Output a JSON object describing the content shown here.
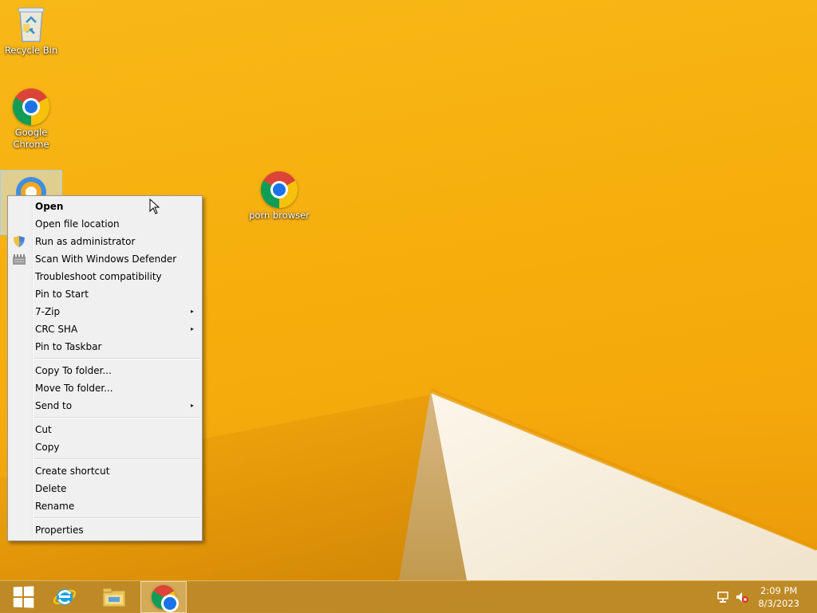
{
  "desktop": {
    "icons": [
      {
        "label": "Recycle Bin",
        "icon": "recycle-bin-icon"
      },
      {
        "label": "Google Chrome",
        "label_line1": "Google",
        "label_line2": "Chrome",
        "icon": "chrome-icon"
      },
      {
        "label": "porn browser",
        "icon": "chrome-icon"
      }
    ],
    "selected_icon": "tor-browser-icon"
  },
  "context_menu": {
    "items": [
      {
        "label": "Open",
        "bold": true
      },
      {
        "label": "Open file location"
      },
      {
        "label": "Run as administrator",
        "icon": "uac-shield-icon"
      },
      {
        "label": "Scan With Windows Defender",
        "icon": "defender-icon"
      },
      {
        "label": "Troubleshoot compatibility"
      },
      {
        "label": "Pin to Start"
      },
      {
        "label": "7-Zip",
        "submenu": true
      },
      {
        "label": "CRC SHA",
        "submenu": true
      },
      {
        "label": "Pin to Taskbar"
      },
      {
        "label": "Copy To folder..."
      },
      {
        "label": "Move To folder..."
      },
      {
        "label": "Send to",
        "submenu": true
      },
      {
        "label": "Cut"
      },
      {
        "label": "Copy"
      },
      {
        "label": "Create shortcut"
      },
      {
        "label": "Delete"
      },
      {
        "label": "Rename"
      },
      {
        "label": "Properties"
      }
    ],
    "submenu_arrow": "▸"
  },
  "taskbar": {
    "buttons": [
      {
        "name": "start",
        "icon": "windows-logo-icon"
      },
      {
        "name": "internet-explorer",
        "icon": "ie-icon"
      },
      {
        "name": "file-explorer",
        "icon": "folder-icon"
      },
      {
        "name": "google-chrome",
        "icon": "chrome-icon",
        "active": true
      }
    ],
    "tray": {
      "network_icon": "network-icon",
      "volume_icon": "volume-muted-icon",
      "time": "2:09 PM",
      "date": "8/3/2023"
    }
  },
  "colors": {
    "wallpaper": "#f6ae0c",
    "taskbar": "#ba8828",
    "menu_bg": "#f0f0f0"
  }
}
